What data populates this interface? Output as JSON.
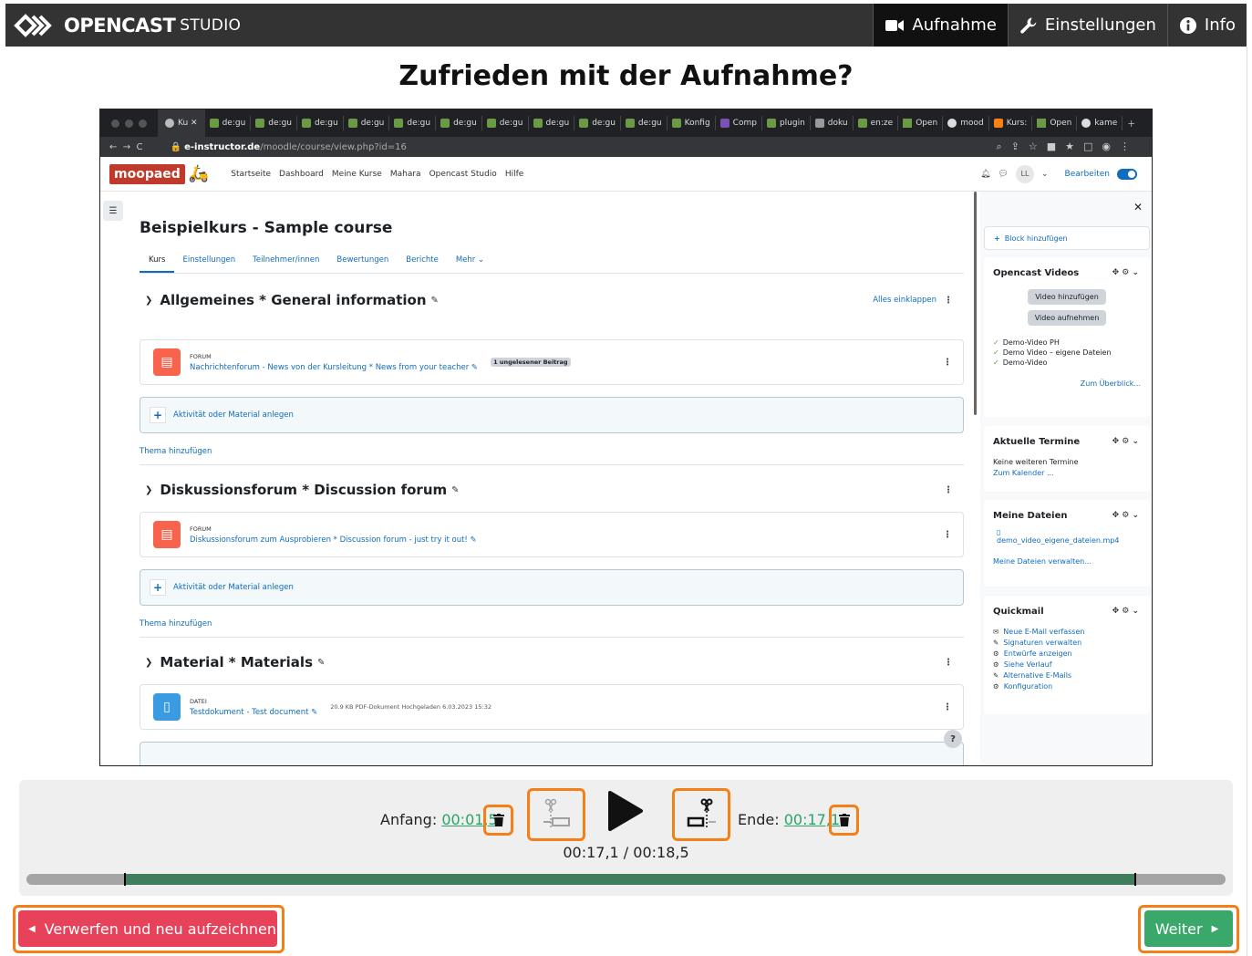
{
  "header": {
    "brand_main": "OPENCAST",
    "brand_sub": "STUDIO",
    "nav": [
      {
        "label": "Aufnahme",
        "icon": "video-camera-icon",
        "active": true
      },
      {
        "label": "Einstellungen",
        "icon": "wrench-icon",
        "active": false
      },
      {
        "label": "Info",
        "icon": "info-icon",
        "active": false
      }
    ]
  },
  "review_title": "Zufrieden mit der Aufnahme?",
  "video": {
    "tabs": [
      "Ku",
      "de:gu",
      "de:gu",
      "de:gu",
      "de:gu",
      "de:gu",
      "de:gu",
      "de:gu",
      "de:gu",
      "de:gu",
      "de:gu",
      "Konfig",
      "Comp",
      "plugin",
      "doku",
      "en:ze",
      "Open",
      "mood",
      "Kurs:",
      "Open",
      "kame"
    ],
    "url_host": "e-instructor.de",
    "url_path": "/moodle/course/view.php?id=16",
    "moodle_logo": "moopaed",
    "moodle_nav": [
      "Startseite",
      "Dashboard",
      "Meine Kurse",
      "Mahara",
      "Opencast Studio",
      "Hilfe"
    ],
    "avatar": "LL",
    "edit_label": "Bearbeiten",
    "course_title": "Beispielkurs - Sample course",
    "course_tabs": [
      "Kurs",
      "Einstellungen",
      "Teilnehmer/innen",
      "Bewertungen",
      "Berichte",
      "Mehr ⌄"
    ],
    "collapse_all": "Alles einklappen",
    "add_activity": "Aktivität oder Material anlegen",
    "add_topic": "Thema hinzufügen",
    "sections": [
      {
        "title": "Allgemeines * General information",
        "activity_type": "FORUM",
        "activity_name": "Nachrichtenforum - News von der Kursleitung * News from your teacher",
        "badge": "1 ungelesener Beitrag"
      },
      {
        "title": "Diskussionsforum * Discussion forum",
        "activity_type": "FORUM",
        "activity_name": "Diskussionsforum zum Ausprobieren * Discussion forum - just try it out!"
      },
      {
        "title": "Material * Materials",
        "activity_type": "DATEI",
        "activity_name": "Testdokument - Test document",
        "meta": "20.9 KB PDF-Dokument Hochgeladen 6.03.2023 15:32"
      }
    ],
    "blocks": {
      "add_block": "Block hinzufügen",
      "opencast": {
        "title": "Opencast Videos",
        "add_video": "Video hinzufügen",
        "record_video": "Video aufnehmen",
        "videos": [
          "Demo-Video PH",
          "Demo Video – eigene Dateien",
          "Demo-Video"
        ],
        "overview": "Zum Überblick..."
      },
      "events": {
        "title": "Aktuelle Termine",
        "none": "Keine weiteren Termine",
        "calendar": "Zum Kalender ..."
      },
      "files": {
        "title": "Meine Dateien",
        "file": "demo_video_eigene_dateien.mp4",
        "manage": "Meine Dateien verwalten..."
      },
      "quickmail": {
        "title": "Quickmail",
        "items": [
          "Neue E-Mail verfassen",
          "Signaturen verwalten",
          "Entwürfe anzeigen",
          "Siehe Verlauf",
          "Alternative E-Mails",
          "Konfiguration"
        ]
      }
    }
  },
  "trim": {
    "start_label": "Anfang:",
    "start_value": "00:01,5",
    "end_label": "Ende:",
    "end_value": "00:17,1",
    "current_time": "00:17,1 / 00:18,5",
    "duration_s": 18.5,
    "start_s": 1.5,
    "end_s": 17.1
  },
  "buttons": {
    "discard": "Verwerfen und neu aufzeichnen",
    "next": "Weiter"
  },
  "colors": {
    "header_bg": "#333333",
    "accent_green": "#3aa86b",
    "discard_red": "#e8425b",
    "highlight_orange": "#f57f17"
  }
}
